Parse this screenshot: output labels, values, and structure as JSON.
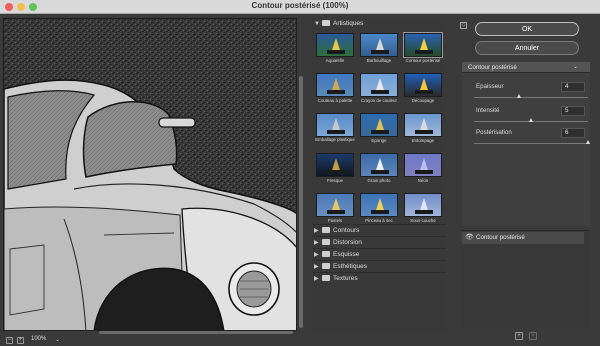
{
  "window": {
    "title": "Contour postérisé (100%)"
  },
  "preview": {
    "zoom": "100%",
    "zoom_out": "−",
    "zoom_in": "+",
    "zoom_menu": "⌄"
  },
  "filters": {
    "open_category": "Artistiques",
    "thumbnails": [
      {
        "label": "Aquarelle",
        "selected": false
      },
      {
        "label": "Barbouillage",
        "selected": false
      },
      {
        "label": "Contour postérisé",
        "selected": true
      },
      {
        "label": "Couteau à palette",
        "selected": false
      },
      {
        "label": "Crayon de couleur",
        "selected": false
      },
      {
        "label": "Découpage",
        "selected": false
      },
      {
        "label": "Emballage plastique",
        "selected": false
      },
      {
        "label": "Eponge",
        "selected": false
      },
      {
        "label": "Estompage",
        "selected": false
      },
      {
        "label": "Fresque",
        "selected": false
      },
      {
        "label": "Grain photo",
        "selected": false
      },
      {
        "label": "Néon",
        "selected": false
      },
      {
        "label": "Pastels",
        "selected": false
      },
      {
        "label": "Pinceau à sec",
        "selected": false
      },
      {
        "label": "Sous-couche",
        "selected": false
      }
    ],
    "categories": [
      "Contours",
      "Distorsion",
      "Esquisse",
      "Esthétiques",
      "Textures"
    ]
  },
  "actions": {
    "ok": "OK",
    "cancel": "Annuler"
  },
  "settings": {
    "filter_select": "Contour postérisé",
    "params": [
      {
        "label": "Epaisseur",
        "value": "4",
        "fraction": 0.4
      },
      {
        "label": "Intensité",
        "value": "5",
        "fraction": 0.5
      },
      {
        "label": "Postérisation",
        "value": "6",
        "fraction": 1.0
      }
    ]
  },
  "layers": {
    "items": [
      "Contour postérisé"
    ],
    "new_icon": "+",
    "delete_icon": "🗑"
  },
  "icons": {
    "eye": "eye-icon",
    "folder": "folder-icon",
    "collapse": "collapse-icon"
  }
}
